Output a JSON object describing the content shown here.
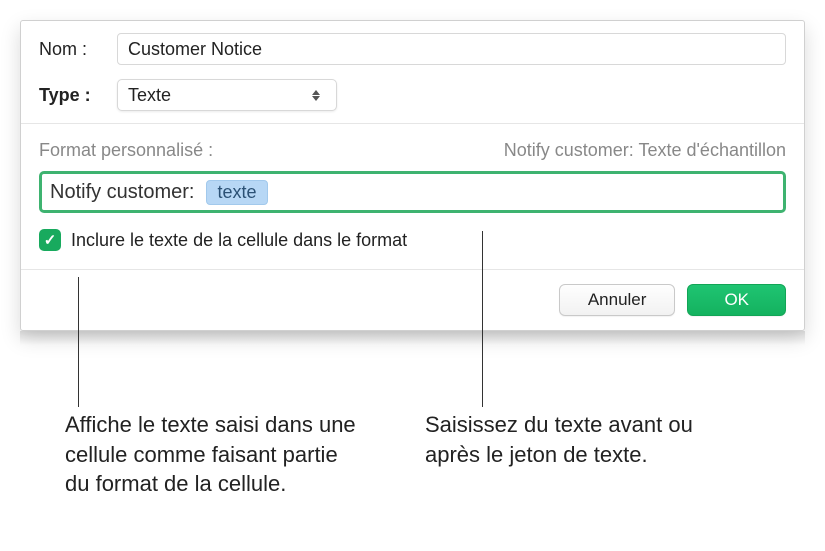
{
  "dialog": {
    "nameLabel": "Nom :",
    "nameValue": "Customer Notice",
    "typeLabel": "Type :",
    "typeValue": "Texte",
    "formatLabel": "Format personnalisé :",
    "sampleText": "Notify customer: Texte d'échantillon",
    "formatPrefix": "Notify customer:",
    "tokenLabel": "texte",
    "checkboxLabel": "Inclure le texte de la cellule dans le format",
    "checkboxChecked": true,
    "cancelLabel": "Annuler",
    "okLabel": "OK"
  },
  "callouts": {
    "left": "Affiche le texte saisi dans une cellule comme faisant partie du format de la cellule.",
    "right": "Saisissez du texte avant ou après le jeton de texte."
  },
  "colors": {
    "accent": "#18aa5e",
    "focusBorder": "#3eb370",
    "tokenBg": "#b7d7f5"
  }
}
